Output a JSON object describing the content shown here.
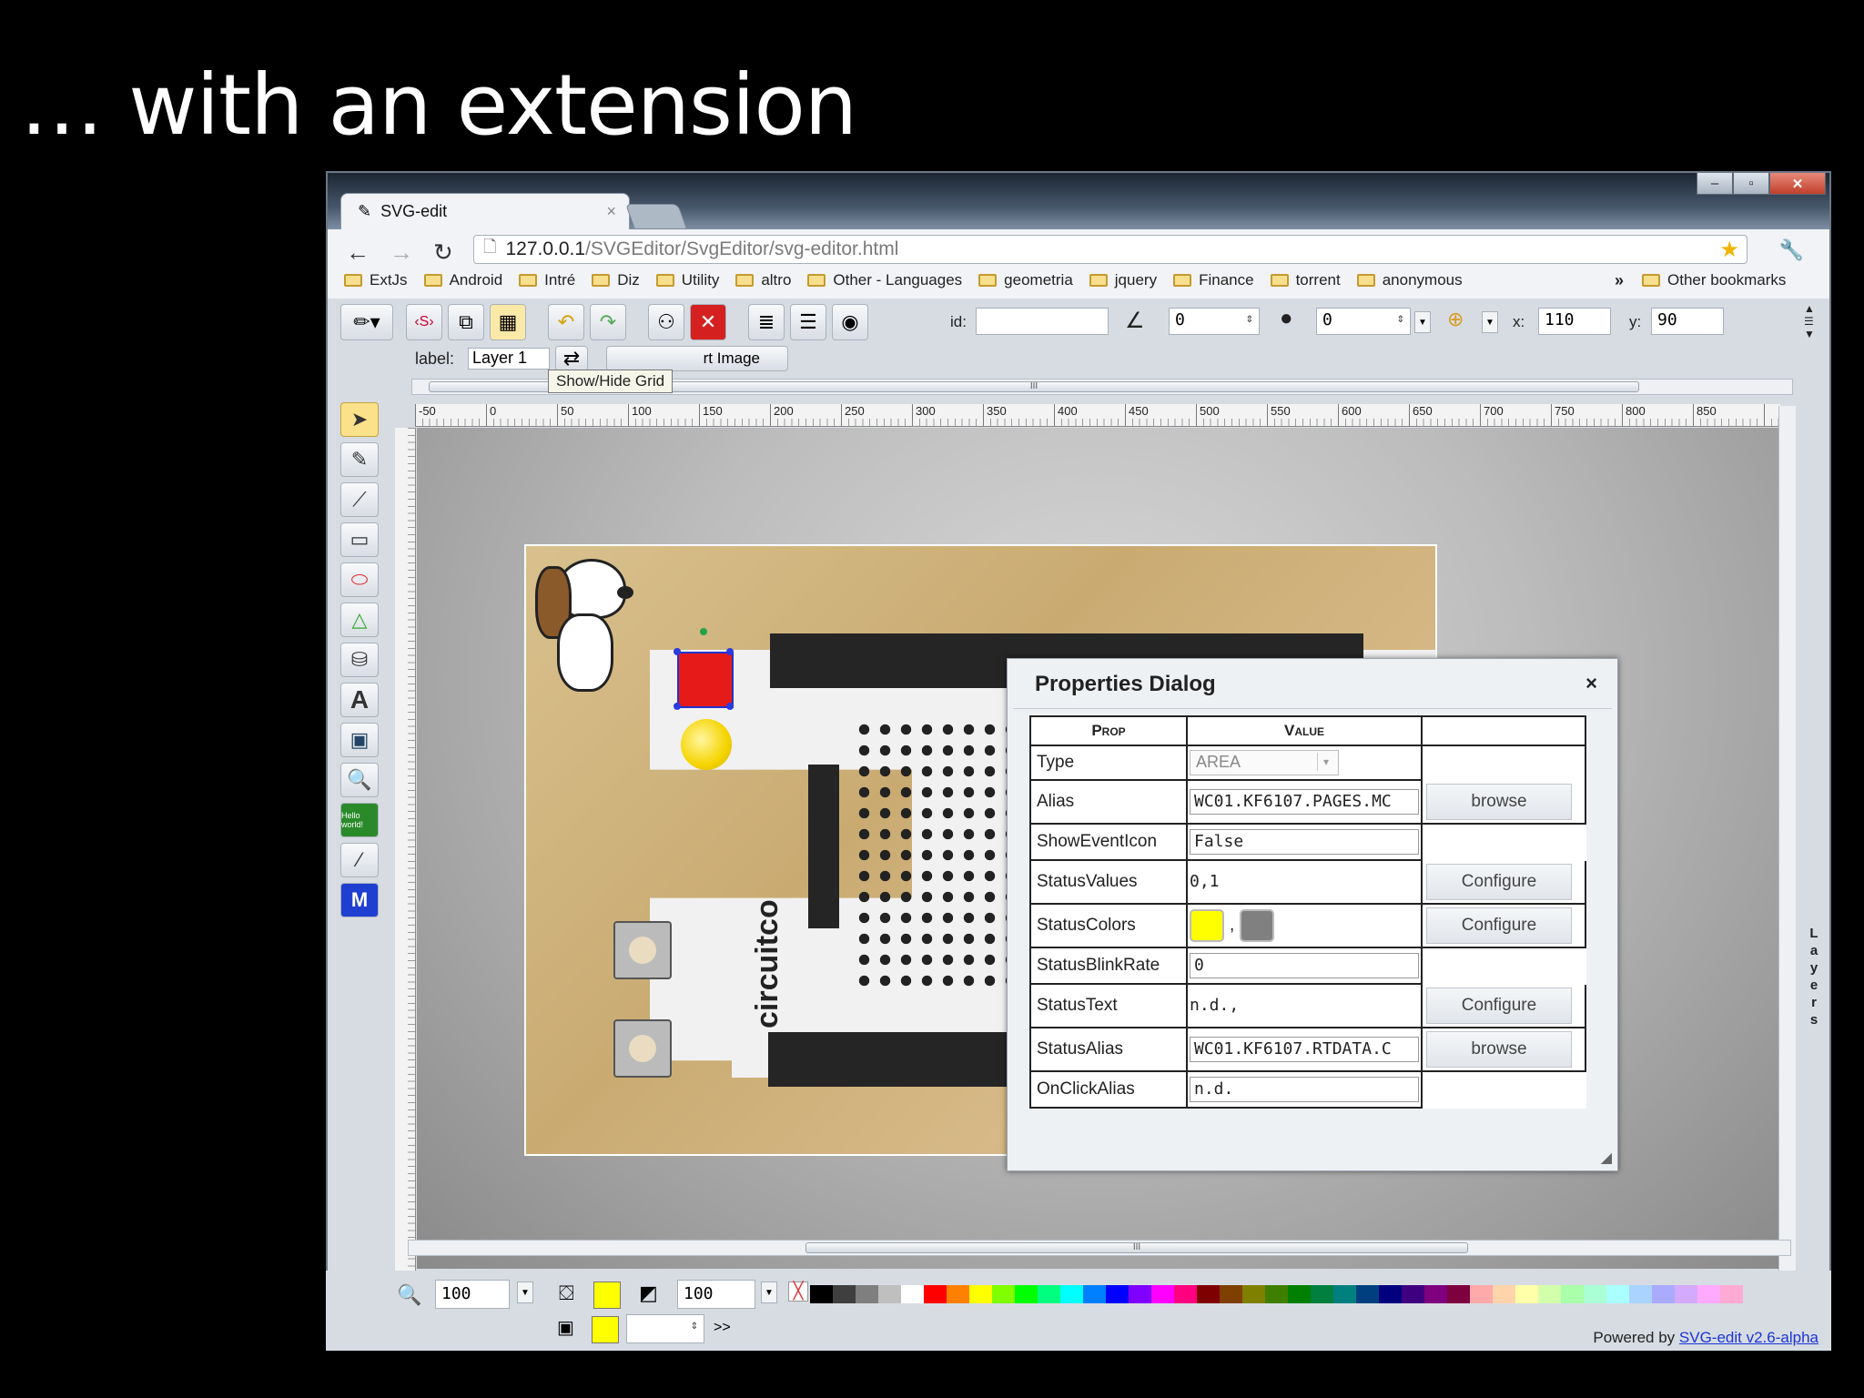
{
  "slide": {
    "title": "… with an extension"
  },
  "browser": {
    "tab_title": "SVG-edit",
    "tab_close": "×",
    "url_host": "127.0.0.1",
    "url_path": "/SVGEditor/SvgEditor/svg-editor.html",
    "bookmarks": [
      "ExtJs",
      "Android",
      "Intré",
      "Diz",
      "Utility",
      "altro",
      "Other - Languages",
      "geometria",
      "jquery",
      "Finance",
      "torrent",
      "anonymous"
    ],
    "bookmarks_more": "»",
    "other_bookmarks": "Other bookmarks"
  },
  "editor": {
    "id_label": "id:",
    "id_value": "",
    "angle_value": "0",
    "blur_value": "0",
    "x_label": "x:",
    "x_value": "110",
    "y_label": "y:",
    "y_value": "90",
    "layer_label": "label:",
    "layer_value": "Layer 1",
    "tooltip": "Show/Hide Grid",
    "hidden_tab_label": "rt Image",
    "ruler_ticks": [
      "-50",
      "0",
      "50",
      "100",
      "150",
      "200",
      "250",
      "300",
      "350",
      "400",
      "450",
      "500",
      "550",
      "600",
      "650",
      "700",
      "750",
      "800",
      "850"
    ],
    "layers_label": "Layers",
    "hello_tool": "Hello world!",
    "m_tool": "M",
    "text_tool": "A",
    "board_label": "circuitco",
    "zoom_value": "100",
    "fill_opacity": "100",
    "stroke_width": "",
    "more_label": ">>",
    "powered_by": "Powered by",
    "powered_link": "SVG-edit v2.6-alpha",
    "fill_color": "#ffff00",
    "stroke_color": "#ffff00"
  },
  "dialog": {
    "title": "Properties Dialog",
    "close": "×",
    "col_prop": "Prop",
    "col_value": "Value",
    "rows": [
      {
        "prop": "Type",
        "value": "AREA",
        "action": ""
      },
      {
        "prop": "Alias",
        "value": "WC01.KF6107.PAGES.MC",
        "action": "browse"
      },
      {
        "prop": "ShowEventIcon",
        "value": "False",
        "action": ""
      },
      {
        "prop": "StatusValues",
        "value": "0,1",
        "action": "Configure"
      },
      {
        "prop": "StatusColors",
        "value": ",",
        "action": "Configure"
      },
      {
        "prop": "StatusBlinkRate",
        "value": "0",
        "action": ""
      },
      {
        "prop": "StatusText",
        "value": "n.d.,",
        "action": "Configure"
      },
      {
        "prop": "StatusAlias",
        "value": "WC01.KF6107.RTDATA.C",
        "action": "browse"
      },
      {
        "prop": "OnClickAlias",
        "value": "n.d.",
        "action": ""
      }
    ],
    "status_colors": [
      "#ffff00",
      "#808080"
    ]
  },
  "palette": [
    "#000000",
    "#3f3f3f",
    "#7f7f7f",
    "#bfbfbf",
    "#ffffff",
    "#ff0000",
    "#ff7f00",
    "#ffff00",
    "#7fff00",
    "#00ff00",
    "#00ff7f",
    "#00ffff",
    "#007fff",
    "#0000ff",
    "#7f00ff",
    "#ff00ff",
    "#ff007f",
    "#7f0000",
    "#7f3f00",
    "#7f7f00",
    "#3f7f00",
    "#007f00",
    "#007f3f",
    "#007f7f",
    "#003f7f",
    "#00007f",
    "#3f007f",
    "#7f007f",
    "#7f003f",
    "#ffaaaa",
    "#ffd4aa",
    "#ffffaa",
    "#d4ffaa",
    "#aaffaa",
    "#aaffd4",
    "#aaffff",
    "#aad4ff",
    "#aaaaff",
    "#d4aaff",
    "#ffaaff",
    "#ffaad4"
  ]
}
